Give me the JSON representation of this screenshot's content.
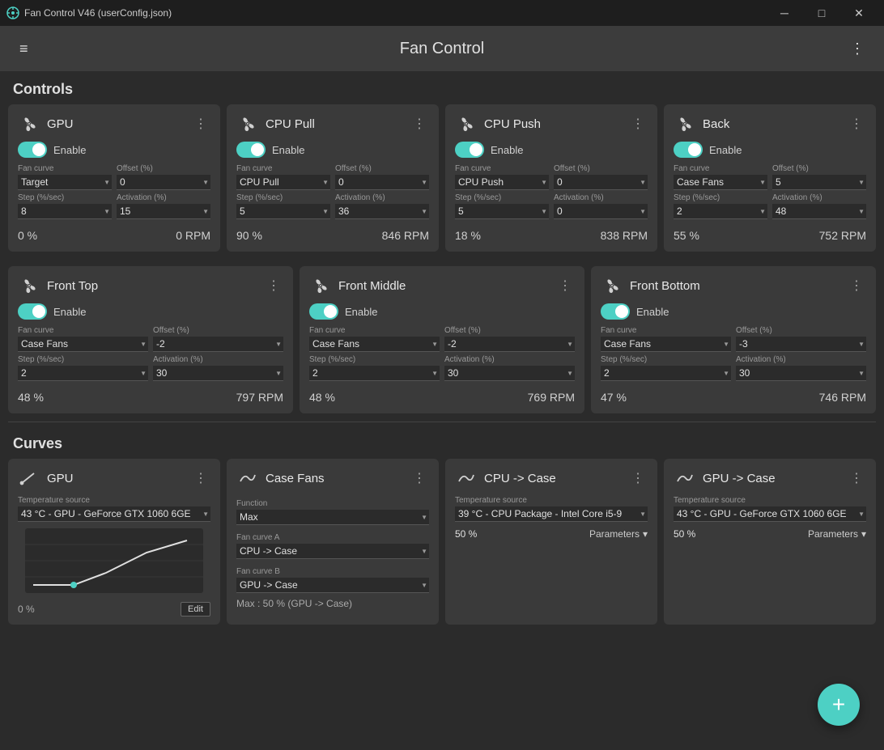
{
  "titlebar": {
    "title": "Fan Control V46 (userConfig.json)",
    "min": "─",
    "max": "□",
    "close": "✕"
  },
  "header": {
    "title": "Fan Control",
    "hamburger": "≡",
    "more": "⋮"
  },
  "controls_section": "Controls",
  "curves_section": "Curves",
  "controls": [
    {
      "name": "GPU",
      "enabled": true,
      "fan_curve_label": "Fan curve",
      "fan_curve": "Target",
      "offset_label": "Offset (%)",
      "offset": "0",
      "step_label": "Step (%/sec)",
      "step": "8",
      "activation_label": "Activation (%)",
      "activation": "15",
      "pct": "0 %",
      "rpm": "0 RPM"
    },
    {
      "name": "CPU Pull",
      "enabled": true,
      "fan_curve_label": "Fan curve",
      "fan_curve": "CPU Pull",
      "offset_label": "Offset (%)",
      "offset": "0",
      "step_label": "Step (%/sec)",
      "step": "5",
      "activation_label": "Activation (%)",
      "activation": "36",
      "pct": "90 %",
      "rpm": "846 RPM"
    },
    {
      "name": "CPU Push",
      "enabled": true,
      "fan_curve_label": "Fan curve",
      "fan_curve": "CPU Push",
      "offset_label": "Offset (%)",
      "offset": "0",
      "step_label": "Step (%/sec)",
      "step": "5",
      "activation_label": "Activation (%)",
      "activation": "0",
      "pct": "18 %",
      "rpm": "838 RPM"
    },
    {
      "name": "Back",
      "enabled": true,
      "fan_curve_label": "Fan curve",
      "fan_curve": "Case Fans",
      "offset_label": "Offset (%)",
      "offset": "5",
      "step_label": "Step (%/sec)",
      "step": "2",
      "activation_label": "Activation (%)",
      "activation": "48",
      "pct": "55 %",
      "rpm": "752 RPM"
    },
    {
      "name": "Front Top",
      "enabled": true,
      "fan_curve_label": "Fan curve",
      "fan_curve": "Case Fans",
      "offset_label": "Offset (%)",
      "offset": "-2",
      "step_label": "Step (%/sec)",
      "step": "2",
      "activation_label": "Activation (%)",
      "activation": "30",
      "pct": "48 %",
      "rpm": "797 RPM"
    },
    {
      "name": "Front Middle",
      "enabled": true,
      "fan_curve_label": "Fan curve",
      "fan_curve": "Case Fans",
      "offset_label": "Offset (%)",
      "offset": "-2",
      "step_label": "Step (%/sec)",
      "step": "2",
      "activation_label": "Activation (%)",
      "activation": "30",
      "pct": "48 %",
      "rpm": "769 RPM"
    },
    {
      "name": "Front Bottom",
      "enabled": true,
      "fan_curve_label": "Fan curve",
      "fan_curve": "Case Fans",
      "offset_label": "Offset (%)",
      "offset": "-3",
      "step_label": "Step (%/sec)",
      "step": "2",
      "activation_label": "Activation (%)",
      "activation": "30",
      "pct": "47 %",
      "rpm": "746 RPM"
    }
  ],
  "curves": [
    {
      "name": "GPU",
      "type": "gpu",
      "temp_source_label": "Temperature source",
      "temp_source": "43 °C - GPU - GeForce GTX 1060 6GE",
      "pct": "0 %",
      "edit_label": "Edit"
    },
    {
      "name": "Case Fans",
      "type": "case_fans",
      "function_label": "Function",
      "function": "Max",
      "fan_curve_a_label": "Fan curve A",
      "fan_curve_a": "CPU -> Case",
      "fan_curve_b_label": "Fan curve B",
      "fan_curve_b": "GPU -> Case",
      "max_info": "Max : 50 % (GPU -> Case)"
    },
    {
      "name": "CPU -> Case",
      "type": "simple",
      "temp_source_label": "Temperature source",
      "temp_source": "39 °C - CPU Package - Intel Core i5-9",
      "pct": "50 %",
      "params_label": "Parameters"
    },
    {
      "name": "GPU -> Case",
      "type": "simple",
      "temp_source_label": "Temperature source",
      "temp_source": "43 °C - GPU - GeForce GTX 1060 6GE",
      "pct": "50 %",
      "params_label": "Parameters"
    }
  ],
  "fab_label": "+"
}
